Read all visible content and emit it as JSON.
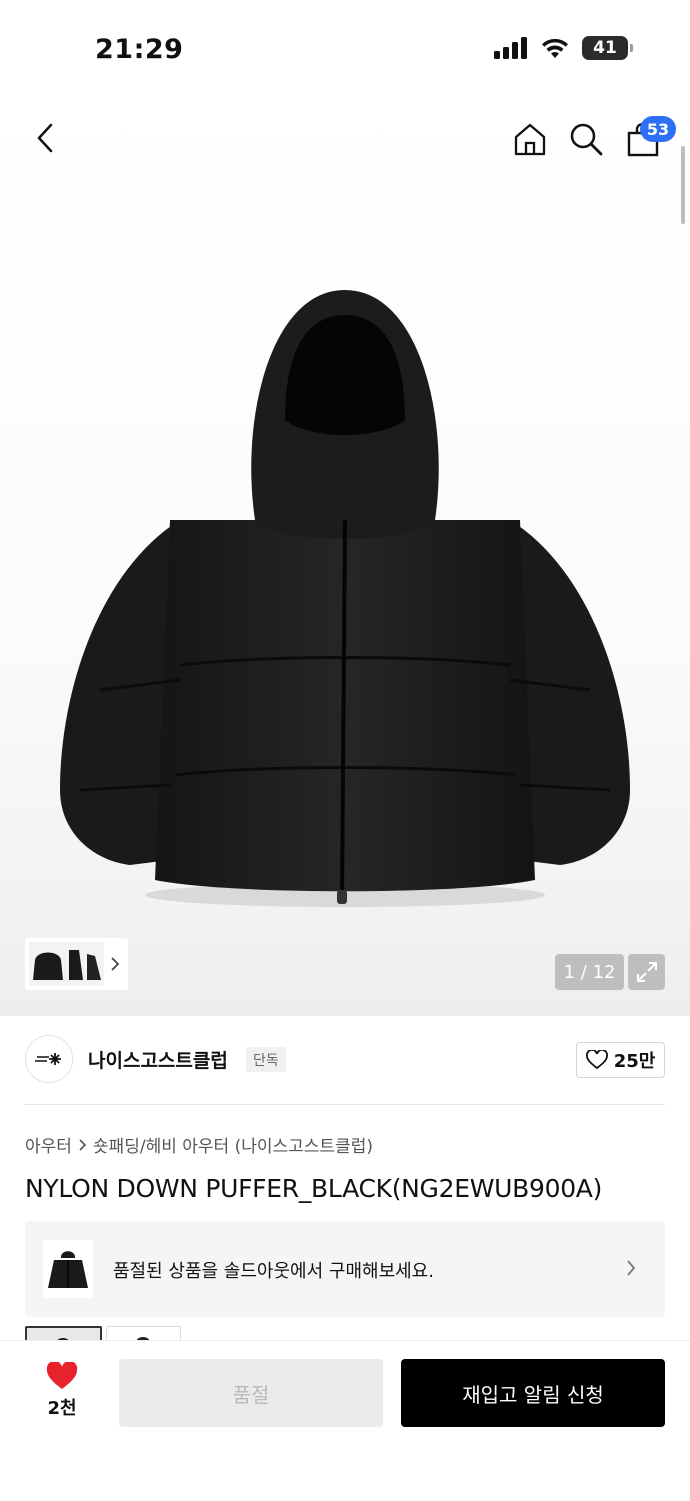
{
  "status_bar": {
    "time": "21:29",
    "battery": "41"
  },
  "nav": {
    "cart_count": "53",
    "icons": [
      "back-icon",
      "home-icon",
      "search-icon",
      "cart-icon"
    ]
  },
  "gallery": {
    "page_counter": "1 / 12"
  },
  "brand": {
    "name": "나이스고스트클럽",
    "tag": "단독",
    "likes": "25만"
  },
  "breadcrumb": {
    "category": "아우터",
    "subcategory": "숏패딩/헤비 아우터 (나이스고스트클럽)"
  },
  "product": {
    "title": "NYLON DOWN PUFFER_BLACK(NG2EWUB900A)"
  },
  "soldout_banner": {
    "text": "품절된 상품을 솔드아웃에서 구매해보세요."
  },
  "bottom_bar": {
    "heart_count": "2천",
    "soldout_label": "품절",
    "restock_label": "재입고 알림 신청"
  },
  "colors": {
    "accent": "#2d6ff5",
    "heart": "#e8222c",
    "primary_button": "#000000"
  }
}
